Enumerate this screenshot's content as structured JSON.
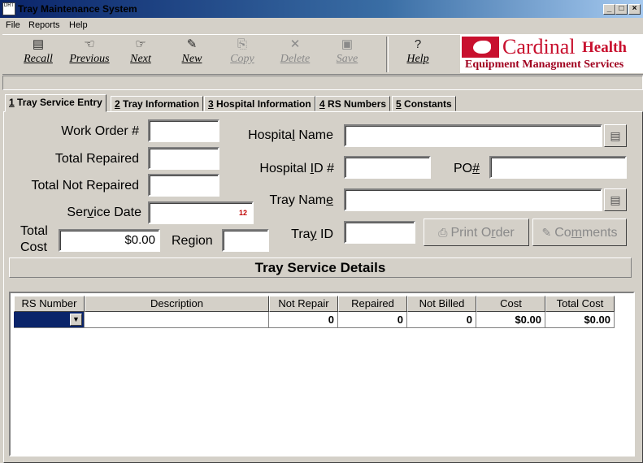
{
  "window": {
    "title": "Tray Maintenance System",
    "icon_text": "DRT"
  },
  "menu": [
    "File",
    "Reports",
    "Help"
  ],
  "toolbar": {
    "recall": "Recall",
    "previous": "Previous",
    "next": "Next",
    "new": "New",
    "copy": "Copy",
    "delete": "Delete",
    "save": "Save",
    "help": "Help"
  },
  "logo": {
    "word1": "Cardinal",
    "word2": "Health",
    "subtitle": "Equipment Managment Services"
  },
  "tabs": [
    {
      "num": "1",
      "label": " Tray Service Entry"
    },
    {
      "num": "2",
      "label": " Tray Information"
    },
    {
      "num": "3",
      "label": " Hospital Information"
    },
    {
      "num": "4",
      "label": " RS Numbers"
    },
    {
      "num": "5",
      "label": " Constants"
    }
  ],
  "form": {
    "work_order_label": "Work Order #",
    "work_order_value": "",
    "total_repaired_label": "Total Repaired",
    "total_repaired_value": "",
    "total_not_repaired_label": "Total Not Repaired",
    "total_not_repaired_value": "",
    "service_date_label_a": "Ser",
    "service_date_label_u": "v",
    "service_date_label_b": "ice Date",
    "service_date_value": "",
    "total_cost_label_1": "Total",
    "total_cost_label_2": "Cost",
    "total_cost_value": "$0.00",
    "region_label": "Region",
    "region_value": "",
    "hospital_name_label_a": "Hospita",
    "hospital_name_label_u": "l",
    "hospital_name_label_b": " Name",
    "hospital_name_value": "",
    "hospital_id_label_a": "Hospital ",
    "hospital_id_label_u": "I",
    "hospital_id_label_b": "D #",
    "hospital_id_value": "",
    "po_label_a": "PO",
    "po_label_u": "#",
    "po_value": "",
    "tray_name_label_a": "Tray Nam",
    "tray_name_label_u": "e",
    "tray_name_value": "",
    "tray_id_label_a": "Tra",
    "tray_id_label_u": "y",
    "tray_id_label_b": " ID",
    "tray_id_value": "",
    "print_order_a": "Print O",
    "print_order_u": "r",
    "print_order_b": "der",
    "comments_a": "Co",
    "comments_u": "m",
    "comments_b": "ments",
    "date_icon_text": "12"
  },
  "details_title": "Tray Service Details",
  "grid": {
    "headers": [
      "RS Number",
      "Description",
      "Not Repair",
      "Repaired",
      "Not Billed",
      "Cost",
      "Total Cost"
    ],
    "rows": [
      {
        "rs_number": "",
        "description": "",
        "not_repair": "0",
        "repaired": "0",
        "not_billed": "0",
        "cost": "$0.00",
        "total_cost": "$0.00"
      }
    ]
  }
}
